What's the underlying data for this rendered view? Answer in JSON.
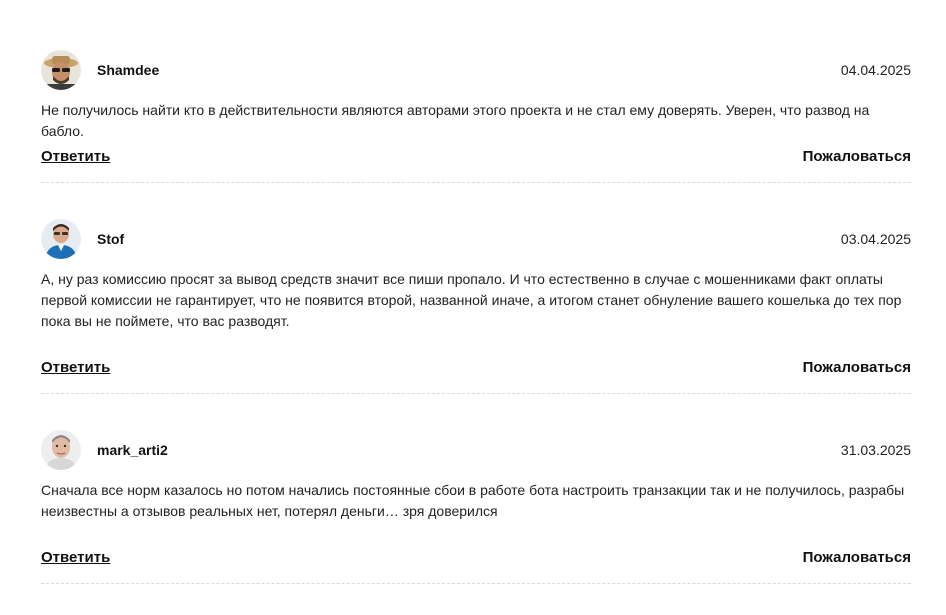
{
  "actions": {
    "reply_label": "Ответить",
    "report_label": "Пожаловаться"
  },
  "comments": [
    {
      "author": "Shamdee",
      "date": "04.04.2025",
      "text": "Не получилось найти кто в действительности являются авторами этого проекта и не стал ему доверять. Уверен, что развод на бабло."
    },
    {
      "author": "Stof",
      "date": "03.04.2025",
      "text": "А, ну раз комиссию просят за вывод средств значит все пиши пропало. И что естественно в случае с мошенниками факт оплаты первой комиссии не гарантирует, что не появится второй, названной иначе, а итогом станет обнуление вашего кошелька до тех пор пока вы не поймете, что вас разводят."
    },
    {
      "author": "mark_arti2",
      "date": "31.03.2025",
      "text": "Сначала все норм казалось но потом начались постоянные сбои в работе бота настроить транзакции так и не получилось, разрабы неизвестны а отзывов реальных нет, потерял деньги… зря доверился"
    }
  ]
}
